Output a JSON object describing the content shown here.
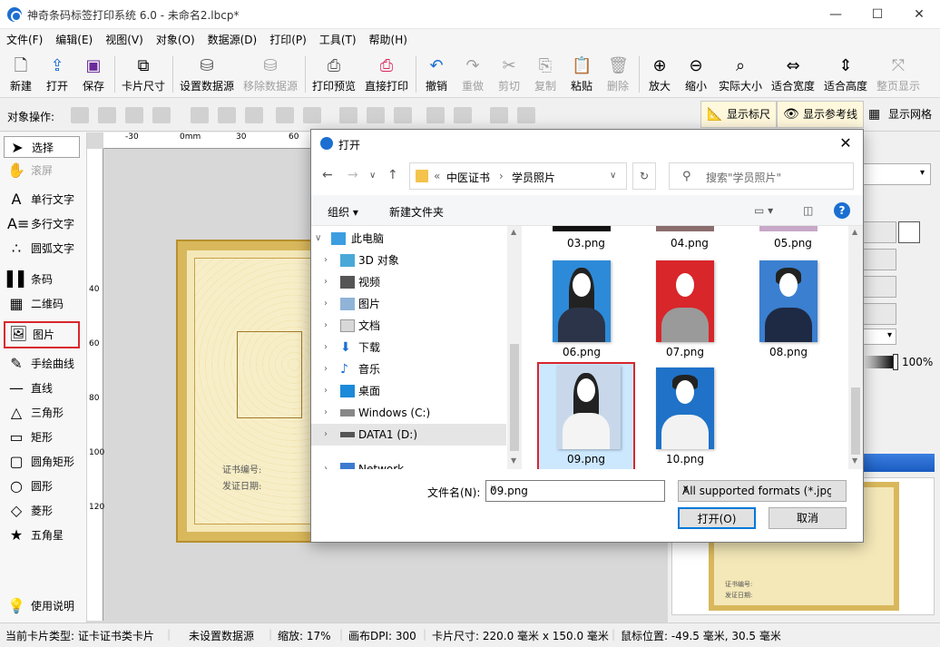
{
  "window": {
    "title": "神奇条码标签打印系统 6.0 - 未命名2.lbcp*"
  },
  "menu": [
    "文件(F)",
    "编辑(E)",
    "视图(V)",
    "对象(O)",
    "数据源(D)",
    "打印(P)",
    "工具(T)",
    "帮助(H)"
  ],
  "toolbar": {
    "new": "新建",
    "open": "打开",
    "save": "保存",
    "card_size": "卡片尺寸",
    "set_datasource": "设置数据源",
    "remove_datasource": "移除数据源",
    "print_preview": "打印预览",
    "direct_print": "直接打印",
    "undo": "撤销",
    "redo": "重做",
    "cut": "剪切",
    "copy": "复制",
    "paste": "粘贴",
    "delete": "删除",
    "zoom_in": "放大",
    "zoom_out": "缩小",
    "actual_size": "实际大小",
    "fit_width": "适合宽度",
    "fit_height": "适合高度",
    "full_page": "整页显示"
  },
  "objbar": {
    "label": "对象操作:",
    "show_ruler": "显示标尺",
    "show_guides": "显示参考线",
    "show_grid": "显示网格"
  },
  "tools": [
    "选择",
    "滚屏",
    "单行文字",
    "多行文字",
    "圆弧文字",
    "条码",
    "二维码",
    "图片",
    "手绘曲线",
    "直线",
    "三角形",
    "矩形",
    "圆角矩形",
    "圆形",
    "菱形",
    "五角星",
    "使用说明"
  ],
  "ruler": {
    "top": [
      "-30",
      "0mm",
      "30",
      "60"
    ],
    "left": [
      "40",
      "60",
      "80",
      "100",
      "120"
    ]
  },
  "certificate": {
    "line1": "证书编号:",
    "line2": "发证日期:"
  },
  "rightpanel": {
    "zoom_value": "100%"
  },
  "status": {
    "card_type": "当前卡片类型: 证卡证书类卡片",
    "datasource": "未设置数据源",
    "zoom": "缩放: 17%",
    "dpi": "画布DPI: 300",
    "card_size": "卡片尺寸: 220.0 毫米 x 150.0 毫米",
    "mouse": "鼠标位置: -49.5 毫米, 30.5 毫米"
  },
  "dialog": {
    "title": "打开",
    "path": [
      "«",
      "中医证书",
      "›",
      "学员照片"
    ],
    "search_placeholder": "搜索\"学员照片\"",
    "organize": "组织 ▾",
    "new_folder": "新建文件夹",
    "help": "?",
    "tree": [
      "此电脑",
      "3D 对象",
      "视频",
      "图片",
      "文档",
      "下载",
      "音乐",
      "桌面",
      "Windows (C:)",
      "DATA1 (D:)",
      "Network"
    ],
    "files_top": [
      "03.png",
      "04.png",
      "05.png"
    ],
    "files": [
      {
        "name": "06.png",
        "bg": "#2d8ad8",
        "hair": true,
        "body": "#2b3448"
      },
      {
        "name": "07.png",
        "bg": "#d8262a",
        "hair": false,
        "body": "#9a9a9a"
      },
      {
        "name": "08.png",
        "bg": "#3b7fd0",
        "hair": false,
        "body": "#1e2a44"
      },
      {
        "name": "09.png",
        "bg": "#c8d8ea",
        "hair": true,
        "body": "#f4f4f4"
      },
      {
        "name": "10.png",
        "bg": "#1f72c8",
        "hair": false,
        "body": "#f2f2f2"
      }
    ],
    "filename_label": "文件名(N):",
    "filename_value": "09.png",
    "format": "All supported formats (*.jpg",
    "open": "打开(O)",
    "cancel": "取消"
  }
}
